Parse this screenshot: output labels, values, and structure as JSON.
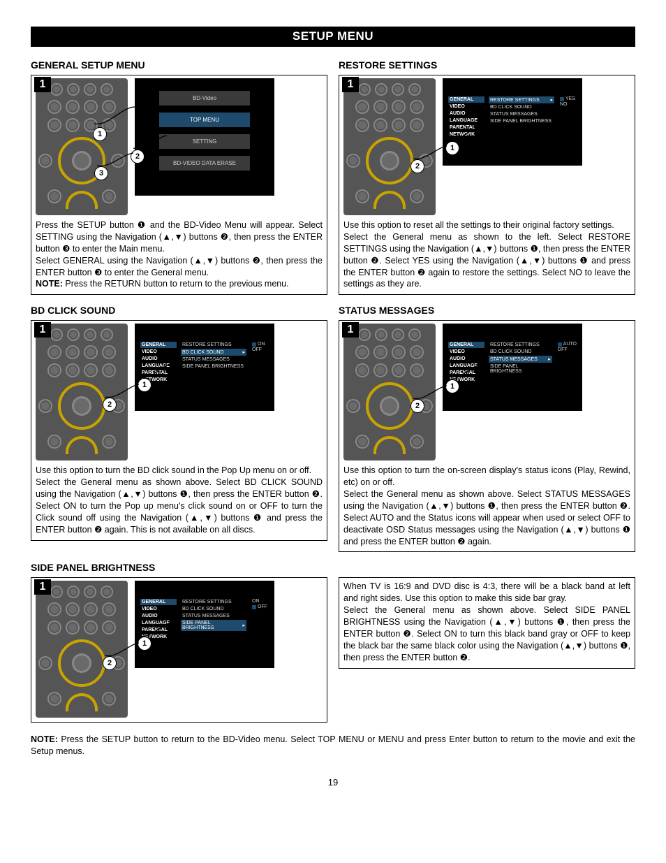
{
  "page_title": "SETUP MENU",
  "page_number": "19",
  "sections": {
    "general": {
      "title": "GENERAL SETUP MENU",
      "tv_items": [
        "BD-Video",
        "TOP MENU",
        "SETTING",
        "BD-VIDEO DATA ERASE"
      ],
      "text_parts": [
        "Press the SETUP button ❶ and the BD-Video Menu will appear. Select SETTING using the Navigation (▲,▼) buttons ❷, then press the ENTER button ❸ to enter the Main menu.",
        "Select GENERAL using the Navigation (▲,▼) buttons ❷, then press the ENTER button ❸ to enter the General menu.",
        "NOTE:",
        " Press the RETURN button to return to the previous menu."
      ]
    },
    "restore": {
      "title": "RESTORE SETTINGS",
      "left_menu": [
        "GENERAL",
        "VIDEO",
        "AUDIO",
        "LANGUAGE",
        "PARENTAL",
        "NETWORK"
      ],
      "right_menu": [
        "RESTORE SETTINGS",
        "BD CLICK SOUND",
        "STATUS MESSAGES",
        "SIDE PANEL BRIGHTNESS"
      ],
      "right_hl": "RESTORE SETTINGS",
      "opts": [
        "YES",
        "NO"
      ],
      "text": "Use this option to reset all the settings to their original factory settings.\nSelect the General menu as shown to the left. Select RESTORE SETTINGS using the Navigation (▲,▼) buttons ❶, then press the ENTER button ❷. Select YES using the Navigation (▲,▼) buttons ❶ and press the ENTER button ❷ again to restore the settings. Select NO to leave the settings as they are."
    },
    "bdclick": {
      "title": "BD CLICK SOUND",
      "left_menu": [
        "GENERAL",
        "VIDEO",
        "AUDIO",
        "LANGUAGE",
        "PARENTAL",
        "NETWORK"
      ],
      "right_menu": [
        "RESTORE SETTINGS",
        "BD CLICK SOUND",
        "STATUS MESSAGES",
        "SIDE PANEL BRIGHTNESS"
      ],
      "right_hl": "BD CLICK SOUND",
      "opts": [
        "ON",
        "OFF"
      ],
      "text": "Use this option to turn the BD click sound in the Pop Up menu on or off.\nSelect the General menu as shown above. Select BD CLICK SOUND using the Navigation (▲,▼) buttons ❶, then press the ENTER button ❷. Select ON to turn the Pop up menu's click sound on or OFF to turn the Click sound off using the Navigation (▲,▼) buttons ❶ and press the ENTER button ❷ again. This is not available on all discs."
    },
    "status": {
      "title": "STATUS MESSAGES",
      "left_menu": [
        "GENERAL",
        "VIDEO",
        "AUDIO",
        "LANGUAGE",
        "PARENTAL",
        "NETWORK"
      ],
      "right_menu": [
        "RESTORE SETTINGS",
        "BD CLICK SOUND",
        "STATUS MESSAGES",
        "SIDE PANEL BRIGHTNESS"
      ],
      "right_hl": "STATUS MESSAGES",
      "opts": [
        "AUTO",
        "OFF"
      ],
      "text": "Use this option to turn the on-screen display's status icons (Play, Rewind, etc) on or off.\nSelect the General menu as shown above. Select STATUS MESSAGES using the Navigation (▲,▼) buttons ❶, then press the ENTER button ❷. Select AUTO and the Status icons will appear when used or select OFF to deactivate OSD Status messages using the Navigation (▲,▼) buttons ❶ and press the ENTER button ❷ again."
    },
    "side": {
      "title": "SIDE PANEL BRIGHTNESS",
      "left_menu": [
        "GENERAL",
        "VIDEO",
        "AUDIO",
        "LANGUAGE",
        "PARENTAL",
        "NETWORK"
      ],
      "right_menu": [
        "RESTORE SETTINGS",
        "BD CLICK SOUND",
        "STATUS MESSAGES",
        "SIDE PANEL BRIGHTNESS"
      ],
      "right_hl": "SIDE PANEL BRIGHTNESS",
      "opts": [
        "ON",
        "OFF"
      ],
      "text": "When TV is 16:9 and DVD disc is 4:3, there will be a black band at left and right sides. Use this option to make this side bar gray.\nSelect the General menu as shown above. Select SIDE PANEL BRIGHTNESS using the Navigation (▲,▼) buttons ❶, then press the ENTER button ❷. Select ON to turn this black band gray or OFF to keep the black bar the same black color using the Navigation (▲,▼) buttons ❶, then press the ENTER button ❷."
    }
  },
  "footnote_label": "NOTE:",
  "footnote_text": " Press the SETUP button to return to the BD-Video menu. Select TOP MENU or MENU and press Enter button to return to the movie and exit the Setup menus.",
  "badge": "1",
  "callouts": {
    "c1": "1",
    "c2": "2",
    "c3": "3"
  }
}
